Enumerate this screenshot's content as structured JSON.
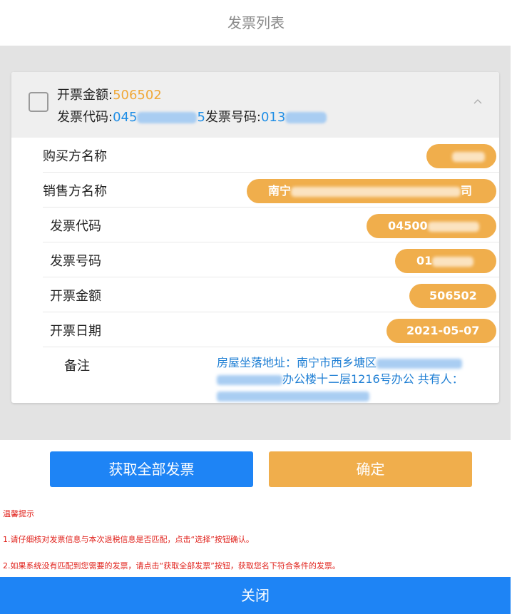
{
  "page": {
    "title": "发票列表"
  },
  "invoice": {
    "head": {
      "amount_label": "开票金额:",
      "amount_value": "506502",
      "code_label": "发票代码:",
      "code_prefix": "045",
      "code_suffix": "5",
      "number_label": "发票号码:",
      "number_prefix": "013"
    },
    "fields": {
      "buyer_label": "购买方名称",
      "seller_label": "销售方名称",
      "seller_value_prefix": "南宁",
      "seller_value_suffix": "司",
      "code_label": "发票代码",
      "code_value": "04500",
      "number_label": "发票号码",
      "number_value": "01",
      "amount_label": "开票金额",
      "amount_value": "506502",
      "date_label": "开票日期",
      "date_value": "2021-05-07",
      "remark_label": "备注",
      "remark_line1": "房屋坐落地址：南宁市西乡塘区",
      "remark_line2": "办公楼十二层1216号办公 共有人："
    }
  },
  "buttons": {
    "get_all": "获取全部发票",
    "confirm": "确定",
    "close": "关闭"
  },
  "tips": {
    "title": "温馨提示",
    "line1": "1.请仔细核对发票信息与本次退税信息是否匹配，点击“选择”按钮确认。",
    "line2": "2.如果系统没有匹配到您需要的发票，请点击“获取全部发票”按钮，获取您名下符合条件的发票。"
  },
  "colors": {
    "accent_blue": "#1e84f5",
    "accent_orange": "#f0ae4c",
    "tip_red": "#e0201a"
  }
}
